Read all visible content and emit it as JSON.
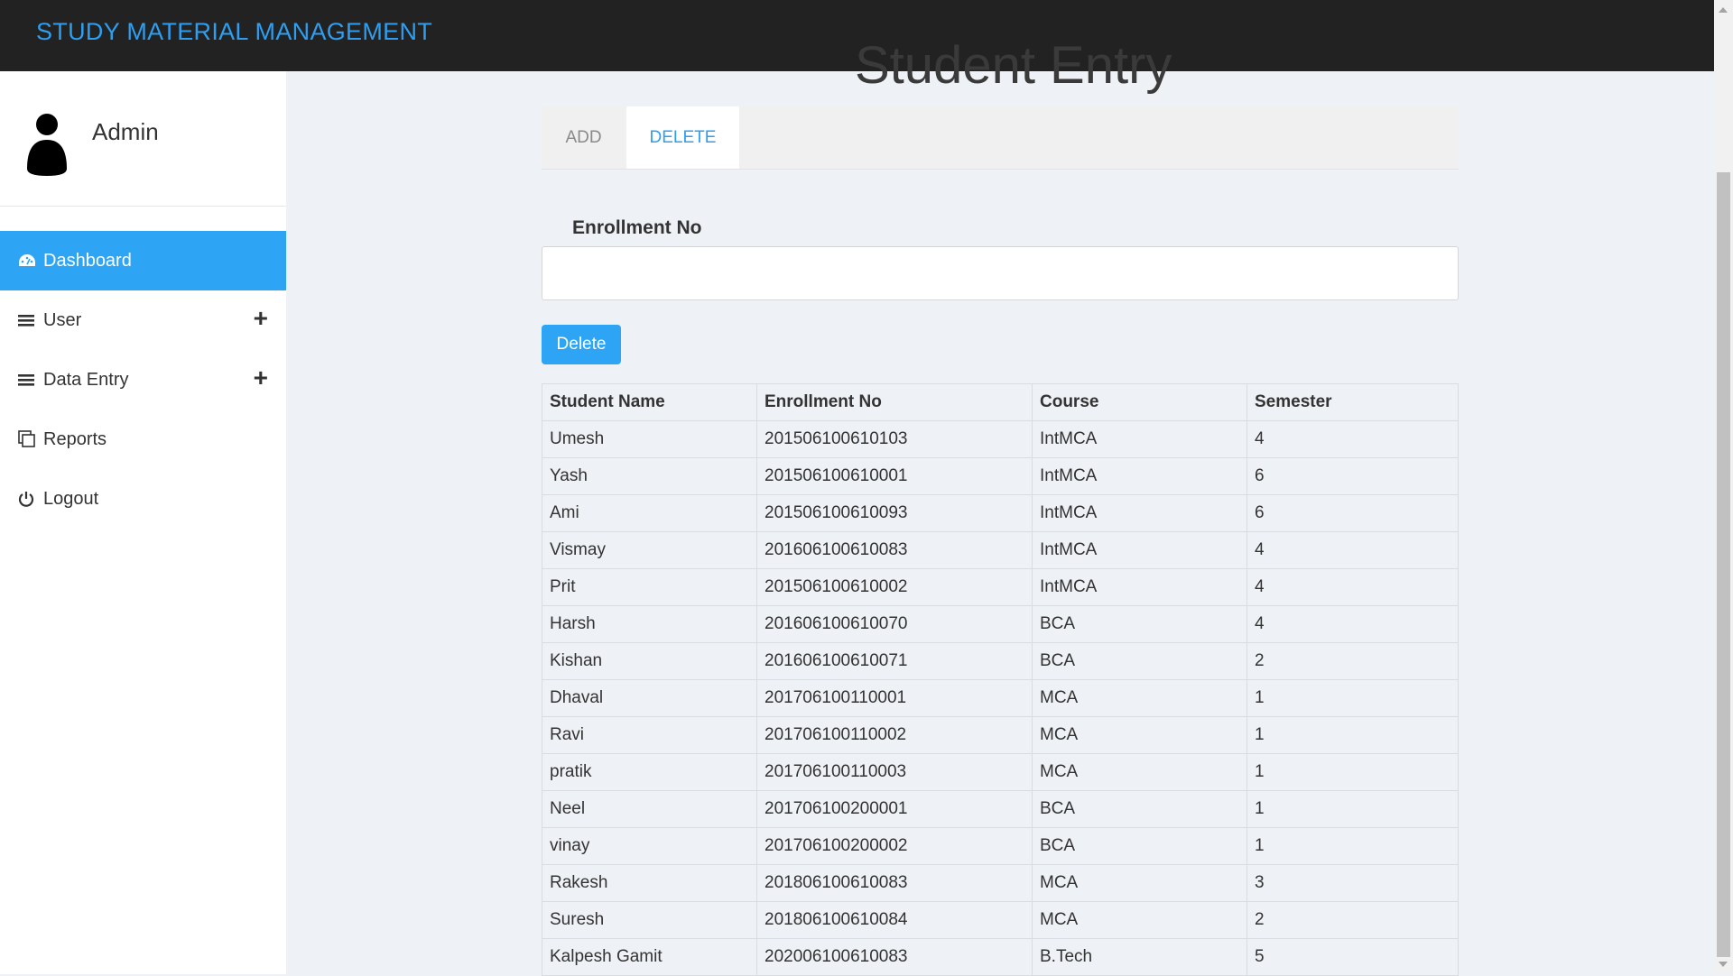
{
  "header": {
    "brand": "STUDY MATERIAL MANAGEMENT"
  },
  "sidebar": {
    "profile_name": "Admin",
    "items": [
      {
        "label": "Dashboard",
        "icon": "dashboard-icon",
        "active": true
      },
      {
        "label": "User",
        "icon": "menu-icon",
        "expandable": true
      },
      {
        "label": "Data Entry",
        "icon": "menu-icon",
        "expandable": true
      },
      {
        "label": "Reports",
        "icon": "copy-icon"
      },
      {
        "label": "Logout",
        "icon": "power-icon"
      }
    ]
  },
  "main": {
    "page_title": "Student Entry",
    "tabs": [
      {
        "label": "ADD",
        "active": false
      },
      {
        "label": "DELETE",
        "active": true
      }
    ],
    "enrollment_label": "Enrollment No",
    "enrollment_value": "",
    "delete_button": "Delete",
    "table": {
      "headers": [
        "Student Name",
        "Enrollment No",
        "Course",
        "Semester"
      ],
      "rows": [
        [
          "Umesh",
          "201506100610103",
          "IntMCA",
          "4"
        ],
        [
          "Yash",
          "201506100610001",
          "IntMCA",
          "6"
        ],
        [
          "Ami",
          "201506100610093",
          "IntMCA",
          "6"
        ],
        [
          "Vismay",
          "201606100610083",
          "IntMCA",
          "4"
        ],
        [
          "Prit",
          "201506100610002",
          "IntMCA",
          "4"
        ],
        [
          "Harsh",
          "201606100610070",
          "BCA",
          "4"
        ],
        [
          "Kishan",
          "201606100610071",
          "BCA",
          "2"
        ],
        [
          "Dhaval",
          "201706100110001",
          "MCA",
          "1"
        ],
        [
          "Ravi",
          "201706100110002",
          "MCA",
          "1"
        ],
        [
          "pratik",
          "201706100110003",
          "MCA",
          "1"
        ],
        [
          "Neel",
          "201706100200001",
          "BCA",
          "1"
        ],
        [
          "vinay",
          "201706100200002",
          "BCA",
          "1"
        ],
        [
          "Rakesh",
          "201806100610083",
          "MCA",
          "3"
        ],
        [
          "Suresh",
          "201806100610084",
          "MCA",
          "2"
        ],
        [
          "Kalpesh Gamit",
          "202006100610083",
          "B.Tech",
          "5"
        ]
      ]
    }
  },
  "colors": {
    "accent": "#2ea4f5",
    "topbar": "#222222",
    "brand": "#2e9ef0"
  }
}
